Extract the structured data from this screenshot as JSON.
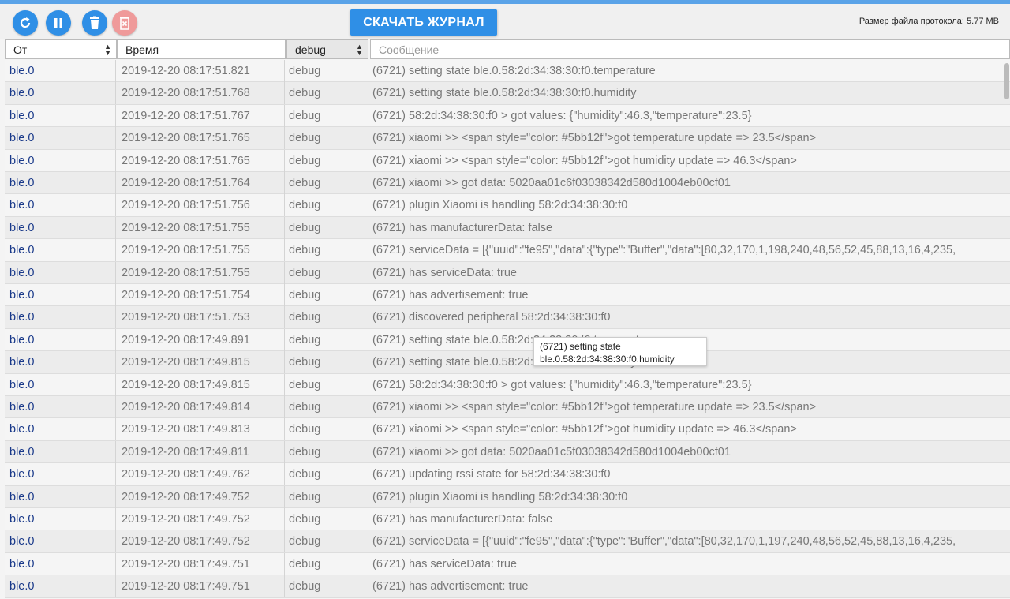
{
  "toolbar": {
    "reload_icon": "reload-icon",
    "pause_icon": "pause-icon",
    "trash_icon": "trash-icon",
    "delete_icon": "delete-icon",
    "download_label": "СКАЧАТЬ ЖУРНАЛ",
    "file_size_label": "Размер файла протокола: 5.77 MB"
  },
  "filters": {
    "from_label": "От",
    "time_label": "Время",
    "level_value": "debug",
    "message_placeholder": "Сообщение"
  },
  "rows": [
    {
      "from": "ble.0",
      "time": "2019-12-20 08:17:51.821",
      "level": "debug",
      "msg": "(6721) setting state ble.0.58:2d:34:38:30:f0.temperature"
    },
    {
      "from": "ble.0",
      "time": "2019-12-20 08:17:51.768",
      "level": "debug",
      "msg": "(6721) setting state ble.0.58:2d:34:38:30:f0.humidity"
    },
    {
      "from": "ble.0",
      "time": "2019-12-20 08:17:51.767",
      "level": "debug",
      "msg": "(6721) 58:2d:34:38:30:f0 > got values: {\"humidity\":46.3,\"temperature\":23.5}"
    },
    {
      "from": "ble.0",
      "time": "2019-12-20 08:17:51.765",
      "level": "debug",
      "msg": "(6721) xiaomi >> <span style=\"color: #5bb12f\">got temperature update => 23.5</span>"
    },
    {
      "from": "ble.0",
      "time": "2019-12-20 08:17:51.765",
      "level": "debug",
      "msg": "(6721) xiaomi >> <span style=\"color: #5bb12f\">got humidity update => 46.3</span>"
    },
    {
      "from": "ble.0",
      "time": "2019-12-20 08:17:51.764",
      "level": "debug",
      "msg": "(6721) xiaomi >> got data: 5020aa01c6f03038342d580d1004eb00cf01"
    },
    {
      "from": "ble.0",
      "time": "2019-12-20 08:17:51.756",
      "level": "debug",
      "msg": "(6721) plugin Xiaomi is handling 58:2d:34:38:30:f0"
    },
    {
      "from": "ble.0",
      "time": "2019-12-20 08:17:51.755",
      "level": "debug",
      "msg": "(6721) has manufacturerData: false"
    },
    {
      "from": "ble.0",
      "time": "2019-12-20 08:17:51.755",
      "level": "debug",
      "msg": "(6721) serviceData = [{\"uuid\":\"fe95\",\"data\":{\"type\":\"Buffer\",\"data\":[80,32,170,1,198,240,48,56,52,45,88,13,16,4,235,"
    },
    {
      "from": "ble.0",
      "time": "2019-12-20 08:17:51.755",
      "level": "debug",
      "msg": "(6721) has serviceData: true"
    },
    {
      "from": "ble.0",
      "time": "2019-12-20 08:17:51.754",
      "level": "debug",
      "msg": "(6721) has advertisement: true"
    },
    {
      "from": "ble.0",
      "time": "2019-12-20 08:17:51.753",
      "level": "debug",
      "msg": "(6721) discovered peripheral 58:2d:34:38:30:f0"
    },
    {
      "from": "ble.0",
      "time": "2019-12-20 08:17:49.891",
      "level": "debug",
      "msg": "(6721) setting state ble.0.58:2d:34:38:30:f0.temperature"
    },
    {
      "from": "ble.0",
      "time": "2019-12-20 08:17:49.815",
      "level": "debug",
      "msg": "(6721) setting state ble.0.58:2d:34:38:30:f0.humidity"
    },
    {
      "from": "ble.0",
      "time": "2019-12-20 08:17:49.815",
      "level": "debug",
      "msg": "(6721) 58:2d:34:38:30:f0 > got values: {\"humidity\":46.3,\"temperature\":23.5}"
    },
    {
      "from": "ble.0",
      "time": "2019-12-20 08:17:49.814",
      "level": "debug",
      "msg": "(6721) xiaomi >> <span style=\"color: #5bb12f\">got temperature update => 23.5</span>"
    },
    {
      "from": "ble.0",
      "time": "2019-12-20 08:17:49.813",
      "level": "debug",
      "msg": "(6721) xiaomi >> <span style=\"color: #5bb12f\">got humidity update => 46.3</span>"
    },
    {
      "from": "ble.0",
      "time": "2019-12-20 08:17:49.811",
      "level": "debug",
      "msg": "(6721) xiaomi >> got data: 5020aa01c5f03038342d580d1004eb00cf01"
    },
    {
      "from": "ble.0",
      "time": "2019-12-20 08:17:49.762",
      "level": "debug",
      "msg": "(6721) updating rssi state for 58:2d:34:38:30:f0"
    },
    {
      "from": "ble.0",
      "time": "2019-12-20 08:17:49.752",
      "level": "debug",
      "msg": "(6721) plugin Xiaomi is handling 58:2d:34:38:30:f0"
    },
    {
      "from": "ble.0",
      "time": "2019-12-20 08:17:49.752",
      "level": "debug",
      "msg": "(6721) has manufacturerData: false"
    },
    {
      "from": "ble.0",
      "time": "2019-12-20 08:17:49.752",
      "level": "debug",
      "msg": "(6721) serviceData = [{\"uuid\":\"fe95\",\"data\":{\"type\":\"Buffer\",\"data\":[80,32,170,1,197,240,48,56,52,45,88,13,16,4,235,"
    },
    {
      "from": "ble.0",
      "time": "2019-12-20 08:17:49.751",
      "level": "debug",
      "msg": "(6721) has serviceData: true"
    },
    {
      "from": "ble.0",
      "time": "2019-12-20 08:17:49.751",
      "level": "debug",
      "msg": "(6721) has advertisement: true"
    }
  ],
  "tooltip": {
    "line1": "(6721) setting state",
    "line2": "ble.0.58:2d:34:38:30:f0.humidity"
  },
  "colors": {
    "accent": "#2f8fe6",
    "source_text": "#1a3a8a",
    "disabled_button": "#ef9a9a"
  }
}
